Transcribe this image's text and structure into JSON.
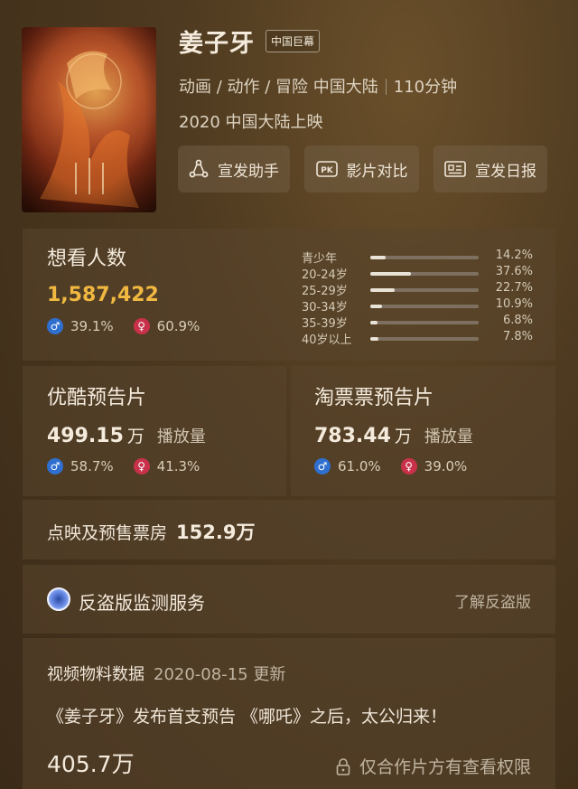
{
  "movie": {
    "title": "姜子牙",
    "badge": "中国巨幕",
    "genres": "动画 / 动作 / 冒险 中国大陆",
    "duration": "110分钟",
    "release": "2020 中国大陆上映"
  },
  "actions": [
    {
      "label": "宣发助手",
      "icon": "share-network-icon"
    },
    {
      "label": "影片对比",
      "icon": "pk-icon",
      "icon_text": "PK"
    },
    {
      "label": "宣发日报",
      "icon": "id-card-icon"
    }
  ],
  "want_to_see": {
    "title": "想看人数",
    "count": "1,587,422",
    "count_color": "#f0b840",
    "male_pct": "39.1%",
    "female_pct": "60.9%",
    "ages": [
      {
        "label": "青少年",
        "pct": "14.2%",
        "value": 14.2
      },
      {
        "label": "20-24岁",
        "pct": "37.6%",
        "value": 37.6
      },
      {
        "label": "25-29岁",
        "pct": "22.7%",
        "value": 22.7
      },
      {
        "label": "30-34岁",
        "pct": "10.9%",
        "value": 10.9
      },
      {
        "label": "35-39岁",
        "pct": "6.8%",
        "value": 6.8
      },
      {
        "label": "40岁以上",
        "pct": "7.8%",
        "value": 7.8
      }
    ]
  },
  "youku": {
    "title": "优酷预告片",
    "value": "499.15",
    "unit": "万",
    "play_label": "播放量",
    "male_pct": "58.7%",
    "female_pct": "41.3%"
  },
  "taopiaopiao": {
    "title": "淘票票预告片",
    "value": "783.44",
    "unit": "万",
    "play_label": "播放量",
    "male_pct": "61.0%",
    "female_pct": "39.0%"
  },
  "presale": {
    "label": "点映及预售票房",
    "value": "152.9万"
  },
  "anti_piracy": {
    "title": "反盗版监测服务",
    "link": "了解反盗版"
  },
  "video": {
    "title": "视频物料数据",
    "date": "2020-08-15 更新",
    "desc": "《姜子牙》发布首支预告 《哪吒》之后，太公归来！",
    "views": "405.7万",
    "lock_text": "仅合作片方有查看权限"
  },
  "icons": {
    "male": "♂",
    "female": "♀"
  }
}
